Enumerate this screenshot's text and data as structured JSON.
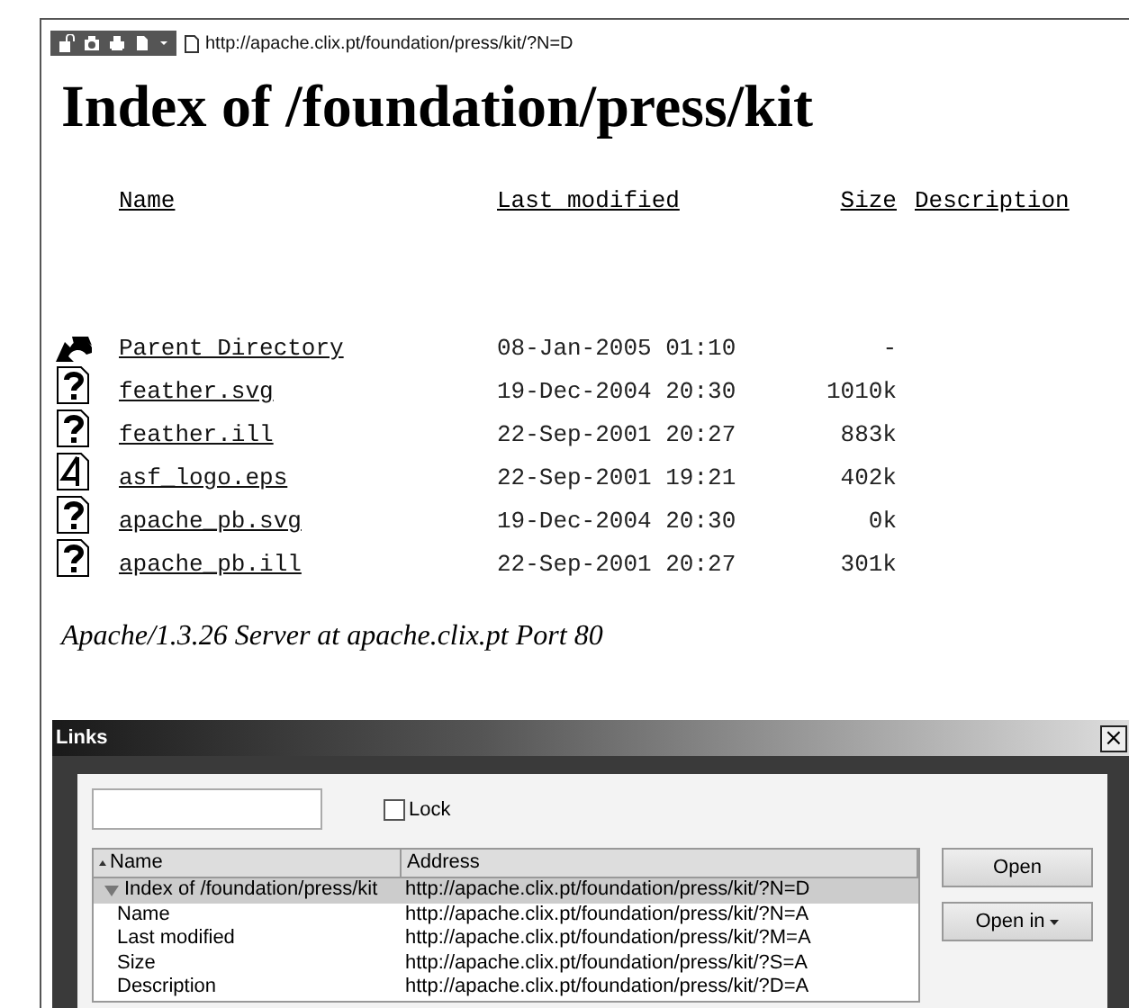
{
  "browser_toolbar": {
    "url": "http://apache.clix.pt/foundation/press/kit/?N=D"
  },
  "heading": "Index of /foundation/press/kit",
  "columns": [
    "Name",
    "Last modified",
    "Size",
    "Description"
  ],
  "files": [
    {
      "kind": "parent",
      "name": "Parent Directory",
      "modified": "08-Jan-2005 01:10",
      "size": "-"
    },
    {
      "kind": "unknown",
      "name": "feather.svg",
      "modified": "19-Dec-2004 20:30",
      "size": "1010k"
    },
    {
      "kind": "unknown",
      "name": "feather.ill",
      "modified": "22-Sep-2001 20:27",
      "size": "883k"
    },
    {
      "kind": "image",
      "name": "asf_logo.eps",
      "modified": "22-Sep-2001 19:21",
      "size": "402k"
    },
    {
      "kind": "unknown",
      "name": "apache_pb.svg",
      "modified": "19-Dec-2004 20:30",
      "size": "0k"
    },
    {
      "kind": "unknown",
      "name": "apache_pb.ill",
      "modified": "22-Sep-2001 20:27",
      "size": "301k"
    }
  ],
  "server_signature": "Apache/1.3.26 Server at apache.clix.pt Port 80",
  "links_dialog": {
    "title": "Links",
    "close": "×",
    "lock": {
      "label": "Lock",
      "checked": false
    },
    "columns": [
      "Name",
      "Address"
    ],
    "rows": [
      {
        "name": "Index of /foundation/press/kit",
        "address": "http://apache.clix.pt/foundation/press/kit/?N=D",
        "selected": true,
        "expanded": true,
        "children": [
          {
            "name": "Name",
            "address": "http://apache.clix.pt/foundation/press/kit/?N=A",
            "selected": false
          },
          {
            "name": "Last modified",
            "address": "http://apache.clix.pt/foundation/press/kit/?M=A",
            "selected": false
          },
          {
            "name": "Size",
            "address": "http://apache.clix.pt/foundation/press/kit/?S=A",
            "selected": false
          },
          {
            "name": "Description",
            "address": "http://apache.clix.pt/foundation/press/kit/?D=A",
            "selected": false
          }
        ]
      }
    ],
    "buttons": [
      {
        "label": "Open",
        "kind": "plain"
      },
      {
        "label": "Open in",
        "kind": "menu"
      }
    ]
  }
}
